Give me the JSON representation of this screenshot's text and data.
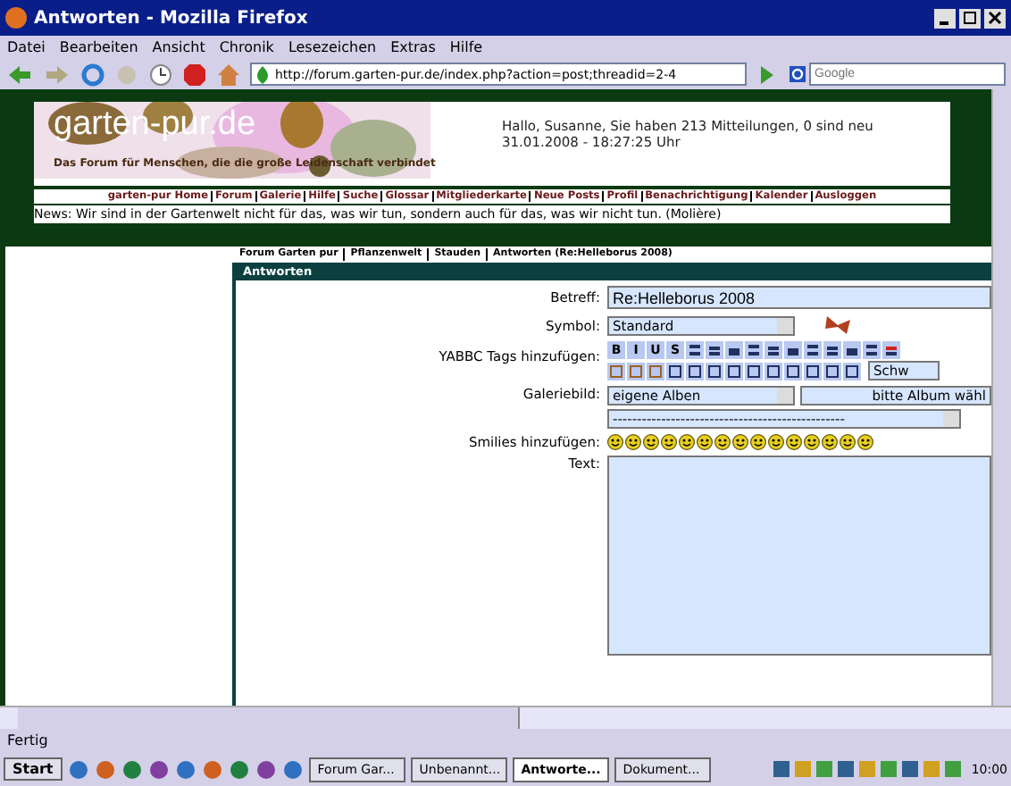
{
  "window": {
    "title": "Antworten - Mozilla Firefox"
  },
  "menu": [
    "Datei",
    "Bearbeiten",
    "Ansicht",
    "Chronik",
    "Lesezeichen",
    "Extras",
    "Hilfe"
  ],
  "address_bar": {
    "value": "http://forum.garten-pur.de/index.php?action=post;threadid=2-4"
  },
  "search": {
    "placeholder": "Google"
  },
  "site": {
    "logo": "garten-pur.de",
    "tagline": "Das Forum für Menschen, die die große Leidenschaft verbindet",
    "greeting": [
      "Hallo, Susanne, Sie haben 213 Mitteilungen, 0 sind neu",
      "31.01.2008 - 18:27:25 Uhr"
    ],
    "nav": [
      "garten-pur Home",
      "Forum",
      "Galerie",
      "Hilfe",
      "Suche",
      "Glossar",
      "Mitgliederkarte",
      "Neue Posts",
      "Profil",
      "Benachrichtigung",
      "Kalender",
      "Ausloggen"
    ],
    "news": "News: Wir sind in der Gartenwelt nicht für das, was wir tun, sondern auch für das, was wir nicht tun. (Molière)"
  },
  "breadcrumb": [
    "Forum Garten pur",
    "Pflanzenwelt",
    "Stauden",
    "Antworten (Re:Helleborus 2008)"
  ],
  "panel": {
    "title": "Antworten",
    "subject": {
      "label": "Betreff:",
      "value": "Re:Helleborus 2008"
    },
    "symbol": {
      "label": "Symbol:",
      "value": "Standard"
    },
    "tags": {
      "label": "YABBC Tags hinzufügen:",
      "buttons": [
        "B",
        "I",
        "U",
        "S"
      ],
      "font_select": "Schw"
    },
    "gallery": {
      "label": "Galeriebild:",
      "album_select": "eigene Alben",
      "album_choose": "bitte Album wähl",
      "image_select": "------------------------------------------------"
    },
    "smilies": {
      "label": "Smilies hinzufügen:"
    },
    "text": {
      "label": "Text:"
    }
  },
  "status": "Fertig",
  "taskbar": {
    "start": "Start",
    "tasks": [
      {
        "label": "Forum Gar...",
        "selected": false
      },
      {
        "label": "Unbenannt...",
        "selected": false
      },
      {
        "label": "Antworte...",
        "selected": true
      },
      {
        "label": "Dokument...",
        "selected": false
      }
    ],
    "clock": "10:00"
  }
}
